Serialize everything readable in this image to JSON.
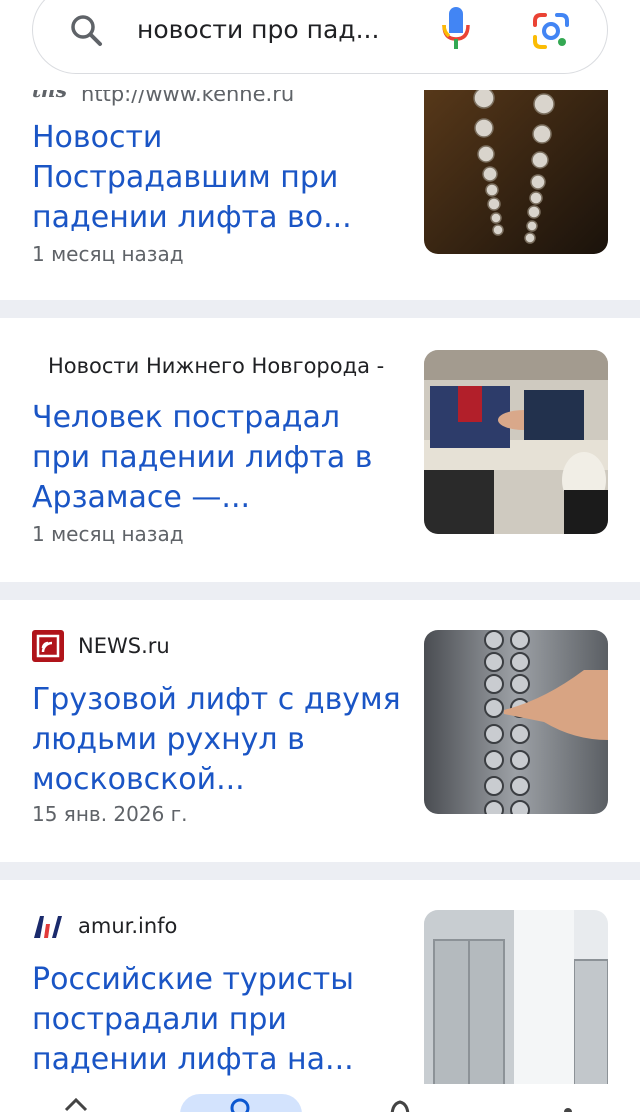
{
  "search": {
    "query": "новости про пад..."
  },
  "results": [
    {
      "source": "http://www.kenhe.ru",
      "title": "Новости Пострадавшим при падении лифта во...",
      "time": "1 месяц назад",
      "thumb_alt": "elevator-buttons-dark"
    },
    {
      "source": "Новости Нижнего Новгорода -",
      "title": "Человек пострадал при падении лифта в Арзамасе —...",
      "time": "1 месяц назад",
      "thumb_alt": "elevator-shaft-person"
    },
    {
      "source": "NEWS.ru",
      "title": "Грузовой лифт с двумя людьми рухнул в московской...",
      "time": "15 янв. 2026 г.",
      "thumb_alt": "finger-pressing-elevator-button"
    },
    {
      "source": "amur.info",
      "title": "Российские туристы пострадали при падении лифта на...",
      "time": "",
      "thumb_alt": "elevator-hall"
    }
  ],
  "colors": {
    "link": "#1a55c5",
    "meta": "#5f6368",
    "divider": "#eceef3"
  }
}
